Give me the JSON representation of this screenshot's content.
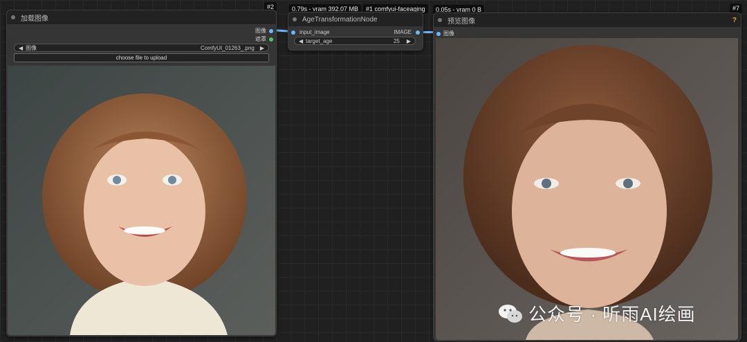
{
  "badges": {
    "load_id": "#2",
    "exec": "0.79s - vram 392.07 MB",
    "age_id": "#1 comfyui-faceaging",
    "preview_exec": "0.05s - vram 0 B",
    "preview_id": "#7"
  },
  "load_node": {
    "title": "加载图像",
    "out_image": "图像",
    "out_mask": "遮罩",
    "image_label": "图像",
    "image_value": "ComfyUI_01263_.png",
    "upload_label": "choose file to upload"
  },
  "age_node": {
    "title": "AgeTransformationNode",
    "in_image": "input_image",
    "out_image": "IMAGE",
    "target_label": "target_age",
    "target_value": "25"
  },
  "preview_node": {
    "title": "预览图像",
    "help": "?",
    "in_image": "图像"
  },
  "watermark": {
    "text": "公众号 · 听雨AI绘画"
  },
  "colors": {
    "link": "#6ab7ff",
    "mask_slot": "#4fc36b",
    "help": "#e6a23c"
  }
}
